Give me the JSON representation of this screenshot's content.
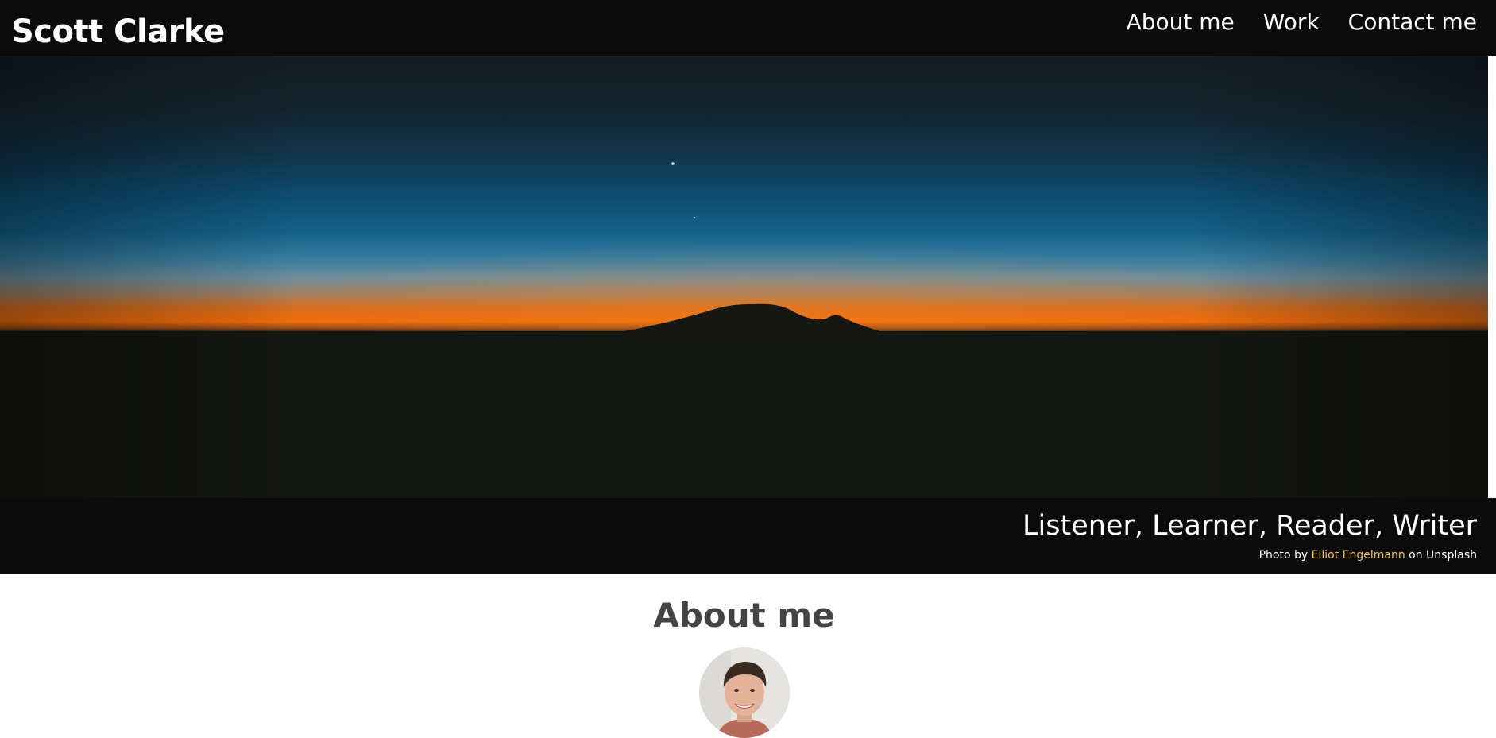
{
  "header": {
    "site_title": "Scott Clarke",
    "nav": [
      {
        "label": "About me"
      },
      {
        "label": "Work"
      },
      {
        "label": "Contact me"
      }
    ]
  },
  "hero": {
    "tagline": "Listener, Learner, Reader, Writer",
    "credit_prefix": "Photo by",
    "credit_author": "Elliot Engelmann",
    "credit_suffix": "on Unsplash"
  },
  "about": {
    "heading": "About me"
  },
  "colors": {
    "header_bg": "#0b0b0b",
    "accent_link": "#f5c242",
    "heading_text": "#444444",
    "page_bg": "#ffffff"
  }
}
